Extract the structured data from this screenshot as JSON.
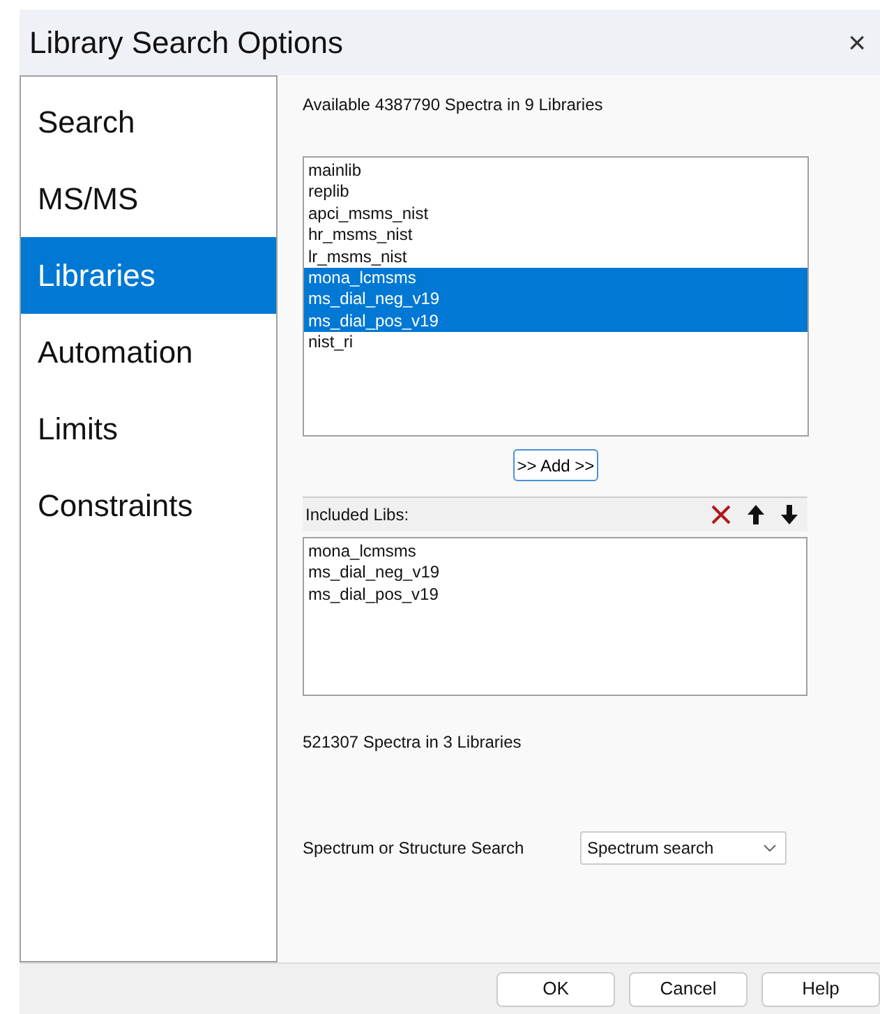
{
  "window": {
    "title": "Library Search Options",
    "close": "×"
  },
  "sidebar": {
    "items": [
      {
        "label": "Search",
        "selected": false
      },
      {
        "label": "MS/MS",
        "selected": false
      },
      {
        "label": "Libraries",
        "selected": true
      },
      {
        "label": "Automation",
        "selected": false
      },
      {
        "label": "Limits",
        "selected": false
      },
      {
        "label": "Constraints",
        "selected": false
      }
    ]
  },
  "available_summary": "Available 4387790 Spectra in 9 Libraries",
  "available_libraries": [
    {
      "label": "mainlib",
      "selected": false
    },
    {
      "label": "replib",
      "selected": false
    },
    {
      "label": "apci_msms_nist",
      "selected": false
    },
    {
      "label": "hr_msms_nist",
      "selected": false
    },
    {
      "label": "lr_msms_nist",
      "selected": false
    },
    {
      "label": "mona_lcmsms",
      "selected": true
    },
    {
      "label": "ms_dial_neg_v19",
      "selected": true
    },
    {
      "label": "ms_dial_pos_v19",
      "selected": true
    },
    {
      "label": "nist_ri",
      "selected": false
    }
  ],
  "add_button": ">> Add >>",
  "included": {
    "header": "Included Libs:",
    "items": [
      "mona_lcmsms",
      "ms_dial_neg_v19",
      "ms_dial_pos_v19"
    ]
  },
  "included_summary": "521307 Spectra in 3 Libraries",
  "search_type": {
    "label": "Spectrum or Structure Search",
    "value": "Spectrum search"
  },
  "buttons": [
    "OK",
    "Cancel",
    "Help"
  ]
}
